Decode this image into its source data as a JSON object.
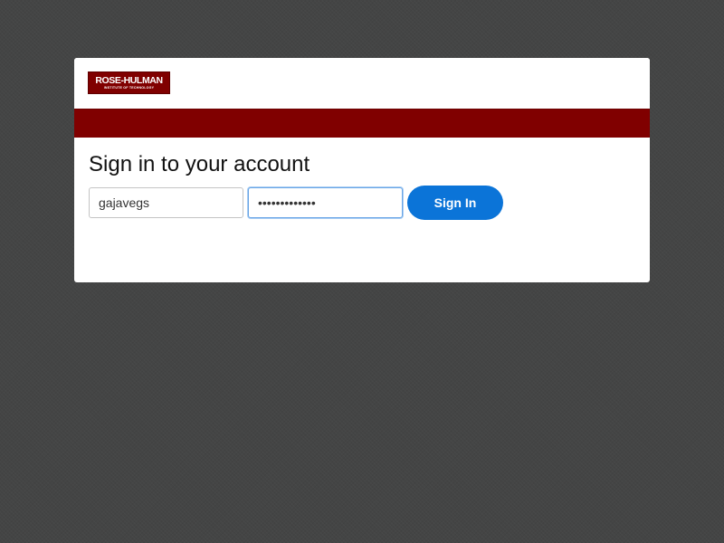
{
  "logo": {
    "name": "ROSE-HULMAN",
    "tagline": "INSTITUTE OF TECHNOLOGY"
  },
  "form": {
    "title": "Sign in to your account",
    "username_value": "gajavegs",
    "password_value": "•••••••••••••",
    "submit_label": "Sign In"
  },
  "colors": {
    "brand": "#800000",
    "button": "#0b74d8",
    "background": "#444545"
  }
}
